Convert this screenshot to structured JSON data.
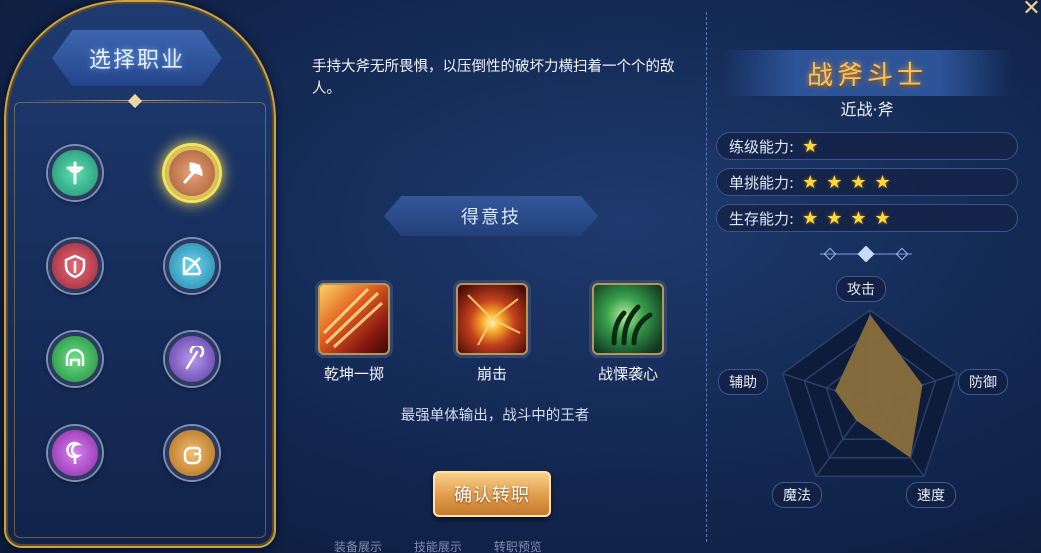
{
  "left_panel": {
    "title": "选择职业",
    "classes": [
      {
        "icon": "holy-cross-icon",
        "color": "#2fb58a",
        "selected": false
      },
      {
        "icon": "axe-icon",
        "color": "#c0743f",
        "selected": true
      },
      {
        "icon": "shield-icon",
        "color": "#c23a4a",
        "selected": false
      },
      {
        "icon": "bow-icon",
        "color": "#3aa6c8",
        "selected": false
      },
      {
        "icon": "helmet-icon",
        "color": "#35a84c",
        "selected": false
      },
      {
        "icon": "staff-icon",
        "color": "#7a55c8",
        "selected": false
      },
      {
        "icon": "moon-staff-icon",
        "color": "#b04ad0",
        "selected": false
      },
      {
        "icon": "fist-icon",
        "color": "#d08a2a",
        "selected": false
      }
    ]
  },
  "description": "手持大斧无所畏惧，以压倒性的破坏力横扫着一个个的敌人。",
  "skills": {
    "banner": "得意技",
    "items": [
      {
        "name": "乾坤一掷",
        "icon": "flame-slash-icon"
      },
      {
        "name": "崩击",
        "icon": "burst-icon"
      },
      {
        "name": "战慄袭心",
        "icon": "claw-icon"
      }
    ],
    "tagline": "最强单体输出，战斗中的王者"
  },
  "confirm_button": "确认转职",
  "bottom_tabs": [
    "装备展示",
    "技能展示",
    "转职预览"
  ],
  "class_info": {
    "name": "战斧斗士",
    "subtitle": "近战·斧",
    "stats": [
      {
        "label": "练级能力:",
        "stars": 1,
        "stars_text": "★"
      },
      {
        "label": "单挑能力:",
        "stars": 4,
        "stars_text": "★★★★"
      },
      {
        "label": "生存能力:",
        "stars": 4,
        "stars_text": "★★★★"
      }
    ]
  },
  "radar": {
    "axes": [
      "攻击",
      "防御",
      "速度",
      "魔法",
      "辅助"
    ],
    "values": [
      0.95,
      0.6,
      0.75,
      0.25,
      0.4
    ],
    "fill_color": "#8a6f3c"
  },
  "close_icon": "close-icon"
}
